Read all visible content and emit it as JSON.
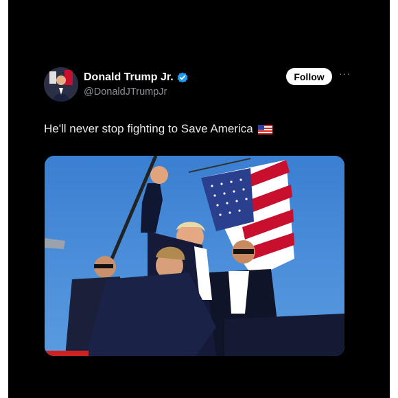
{
  "post": {
    "author_name": "Donald Trump Jr.",
    "author_handle": "@DonaldJTrumpJr",
    "follow_label": "Follow",
    "more_label": "···",
    "text": "He'll never stop fighting to Save America",
    "verified_color": "#1d9bf0",
    "icons": [
      "avatar",
      "verified-badge-icon",
      "more-options-icon",
      "us-flag-emoji-icon"
    ]
  },
  "media": {
    "subject": "photo",
    "sky_color": "#3f86d6"
  }
}
